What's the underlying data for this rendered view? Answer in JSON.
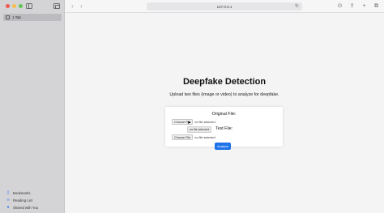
{
  "browser": {
    "tab_title": "1 Tab",
    "address": "127.0.0.1"
  },
  "sidebar": {
    "bottom_links": [
      {
        "label": "Bookmarks",
        "icon": "bookmark-icon"
      },
      {
        "label": "Reading List",
        "icon": "reading-list-icon"
      },
      {
        "label": "Shared with You",
        "icon": "shared-icon"
      }
    ]
  },
  "page": {
    "title": "Deepfake Detection",
    "subtitle": "Upload two files (image or video) to analyze for deepfake.",
    "original_label": "Original File:",
    "test_label": "Test File:",
    "choose_file": "Choose File",
    "no_file": "no file selected",
    "tooltip": "no file selected",
    "analyze": "Analyze"
  }
}
